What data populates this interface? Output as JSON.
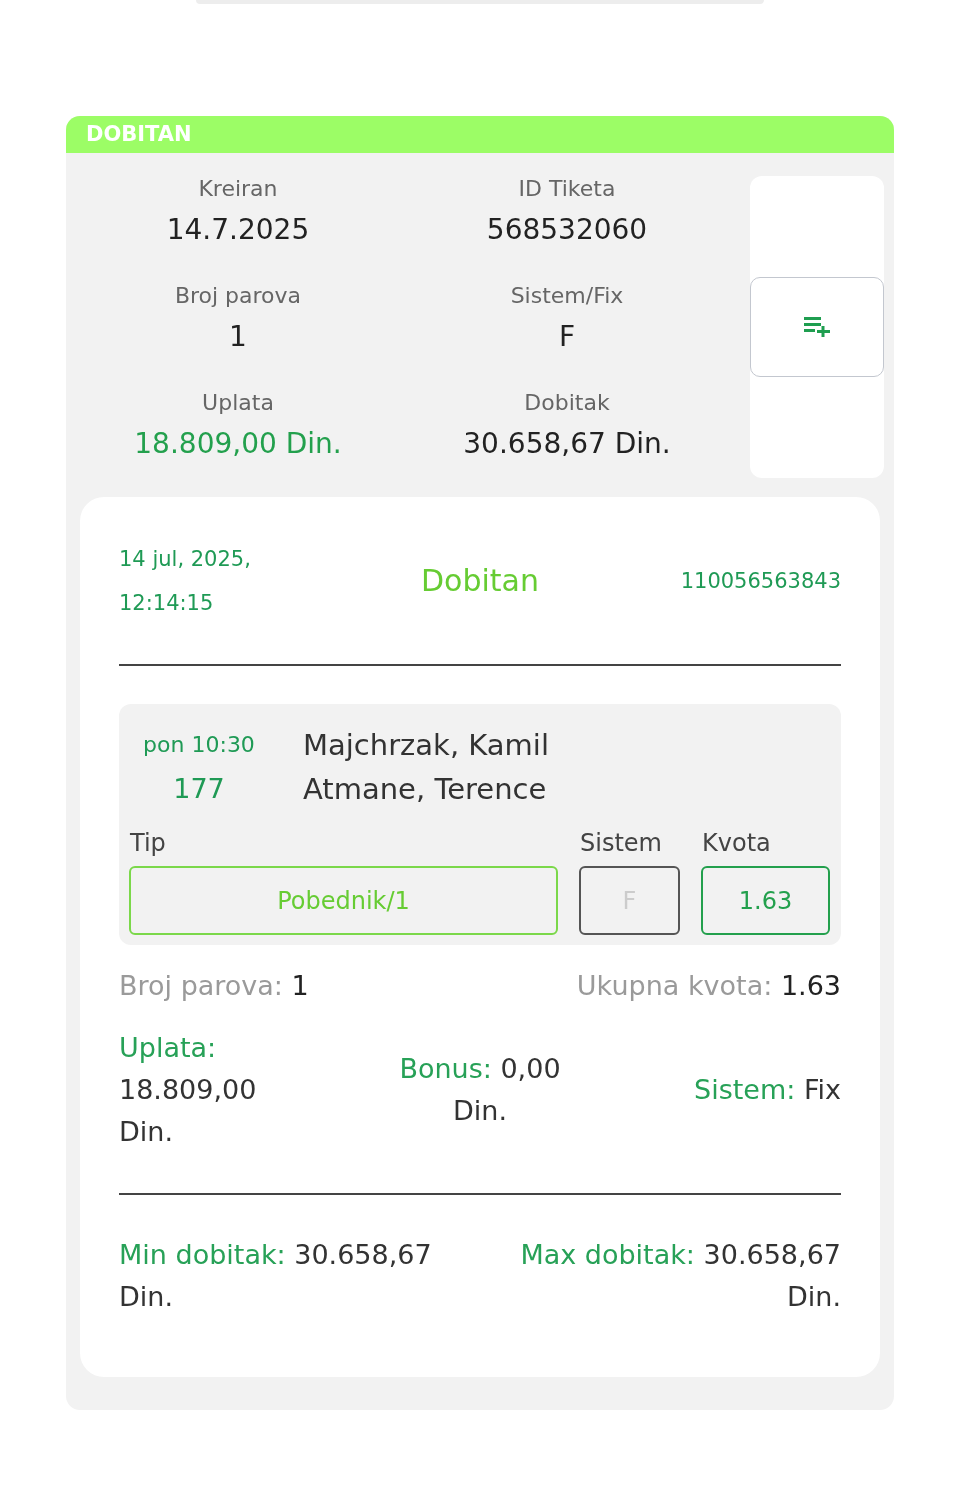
{
  "status_banner": {
    "label": "DOBITAN"
  },
  "summary": {
    "items": [
      {
        "label": "Kreiran",
        "value": "14.7.2025",
        "highlighted": false
      },
      {
        "label": "ID Tiketa",
        "value": "568532060",
        "highlighted": false
      },
      {
        "label": "Broj parova",
        "value": "1",
        "highlighted": false
      },
      {
        "label": "Sistem/Fix",
        "value": "F",
        "highlighted": false
      },
      {
        "label": "Uplata",
        "value": "18.809,00 Din.",
        "highlighted": true
      },
      {
        "label": "Dobitak",
        "value": "30.658,67 Din.",
        "highlighted": false
      }
    ]
  },
  "ticket": {
    "date": "14 jul, 2025,",
    "time": "12:14:15",
    "status": "Dobitan",
    "code": "110056563843",
    "events": [
      {
        "day_time": "pon 10:30",
        "number": "177",
        "home": "Majchrzak, Kamil",
        "away": "Atmane, Terence",
        "picks": [
          {
            "kind": "tip",
            "label": "Tip",
            "value": "Pobednik/1"
          },
          {
            "kind": "system",
            "label": "Sistem",
            "value": "F"
          },
          {
            "kind": "odds",
            "label": "Kvota",
            "value": "1.63"
          }
        ]
      }
    ],
    "totals": [
      {
        "label": "Broj parova:",
        "value": "1"
      },
      {
        "label": "Ukupna kvota:",
        "value": "1.63"
      }
    ],
    "amounts": [
      {
        "label": "Uplata:",
        "value": "18.809,00 Din."
      },
      {
        "label": "Bonus:",
        "value": "0,00 Din."
      },
      {
        "label": "Sistem:",
        "value": "Fix"
      }
    ],
    "winnings": [
      {
        "label": "Min dobitak:",
        "value": "30.658,67 Din."
      },
      {
        "label": "Max dobitak:",
        "value": "30.658,67 Din."
      }
    ]
  }
}
